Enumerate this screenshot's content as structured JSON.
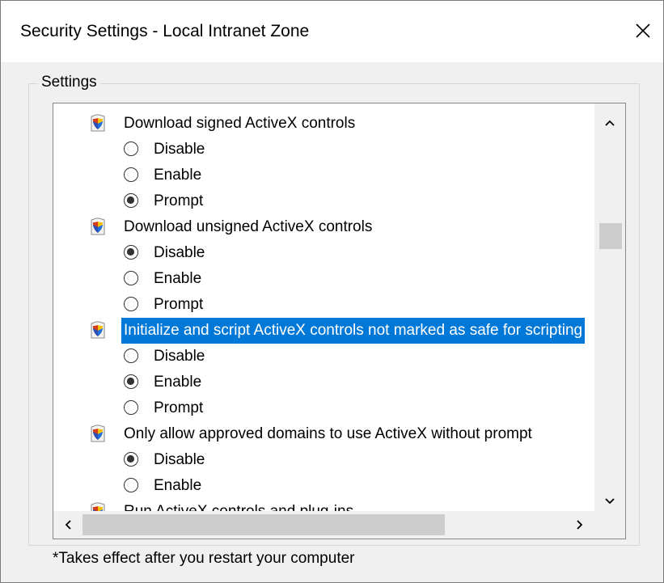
{
  "window": {
    "title": "Security Settings - Local Intranet Zone",
    "close_icon": "close-icon"
  },
  "settings": {
    "group_label": "Settings",
    "items": [
      {
        "label": "Download signed ActiveX controls",
        "icon": "shield-icon",
        "selected": false,
        "options": [
          {
            "label": "Disable",
            "checked": false
          },
          {
            "label": "Enable",
            "checked": false
          },
          {
            "label": "Prompt",
            "checked": true
          }
        ]
      },
      {
        "label": "Download unsigned ActiveX controls",
        "icon": "shield-icon",
        "selected": false,
        "options": [
          {
            "label": "Disable",
            "checked": true
          },
          {
            "label": "Enable",
            "checked": false
          },
          {
            "label": "Prompt",
            "checked": false
          }
        ]
      },
      {
        "label": "Initialize and script ActiveX controls not marked as safe for scripting",
        "icon": "shield-icon",
        "selected": true,
        "options": [
          {
            "label": "Disable",
            "checked": false
          },
          {
            "label": "Enable",
            "checked": true
          },
          {
            "label": "Prompt",
            "checked": false
          }
        ]
      },
      {
        "label": "Only allow approved domains to use ActiveX without prompt",
        "icon": "shield-icon",
        "selected": false,
        "options": [
          {
            "label": "Disable",
            "checked": true
          },
          {
            "label": "Enable",
            "checked": false
          }
        ]
      },
      {
        "label": "Run ActiveX controls and plug-ins",
        "icon": "shield-icon",
        "selected": false,
        "options": []
      }
    ],
    "scrollbars": {
      "up_icon": "chevron-up-icon",
      "down_icon": "chevron-down-icon",
      "left_icon": "chevron-left-icon",
      "right_icon": "chevron-right-icon"
    }
  },
  "footnote": "*Takes effect after you restart your computer",
  "colors": {
    "selection": "#0078d7",
    "window_bg": "#f0f0f0",
    "list_bg": "#ffffff"
  }
}
